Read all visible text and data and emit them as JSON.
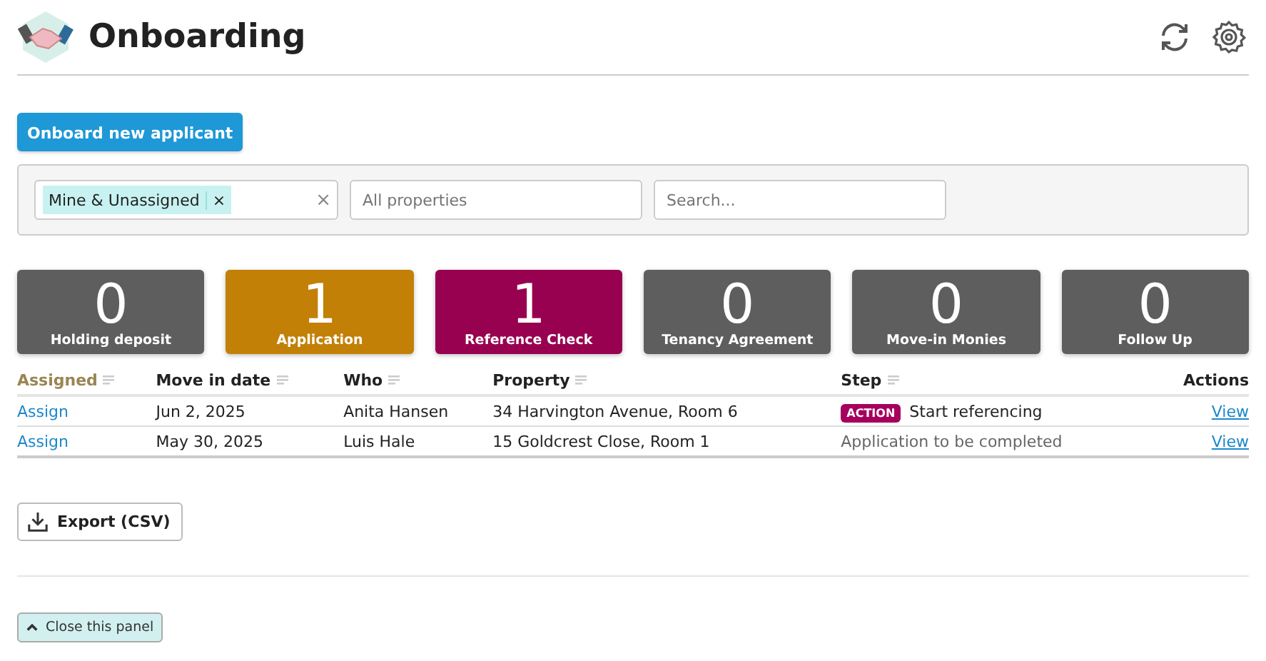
{
  "header": {
    "title": "Onboarding"
  },
  "primary_button": "Onboard new applicant",
  "filters": {
    "tag": "Mine & Unassigned",
    "tag_remove": "×",
    "clear": "×",
    "property_placeholder": "All properties",
    "search_placeholder": "Search..."
  },
  "stages": [
    {
      "count": "0",
      "label": "Holding deposit",
      "color": "#5e5e5e"
    },
    {
      "count": "1",
      "label": "Application",
      "color": "#c28006"
    },
    {
      "count": "1",
      "label": "Reference Check",
      "color": "#980050"
    },
    {
      "count": "0",
      "label": "Tenancy Agreement",
      "color": "#5e5e5e"
    },
    {
      "count": "0",
      "label": "Move-in Monies",
      "color": "#5e5e5e"
    },
    {
      "count": "0",
      "label": "Follow Up",
      "color": "#5e5e5e"
    }
  ],
  "table": {
    "columns": [
      {
        "label": "Assigned",
        "sortable": true,
        "sorted": true
      },
      {
        "label": "Move in date",
        "sortable": true,
        "sorted": false
      },
      {
        "label": "Who",
        "sortable": true,
        "sorted": false
      },
      {
        "label": "Property",
        "sortable": true,
        "sorted": false
      },
      {
        "label": "Step",
        "sortable": true,
        "sorted": false
      },
      {
        "label": "Actions",
        "sortable": false,
        "sorted": false
      }
    ],
    "rows": [
      {
        "assigned": "Assign",
        "move_in": "Jun 2, 2025",
        "who": "Anita Hansen",
        "property": "34 Harvington Avenue, Room 6",
        "step": {
          "kind": "action",
          "badge": "ACTION",
          "text": "Start referencing"
        },
        "action": "View"
      },
      {
        "assigned": "Assign",
        "move_in": "May 30, 2025",
        "who": "Luis Hale",
        "property": "15 Goldcrest Close, Room 1",
        "step": {
          "kind": "pending",
          "text": "Application to be completed"
        },
        "action": "View"
      }
    ]
  },
  "export_button": "Export (CSV)",
  "close_panel": "Close this panel"
}
